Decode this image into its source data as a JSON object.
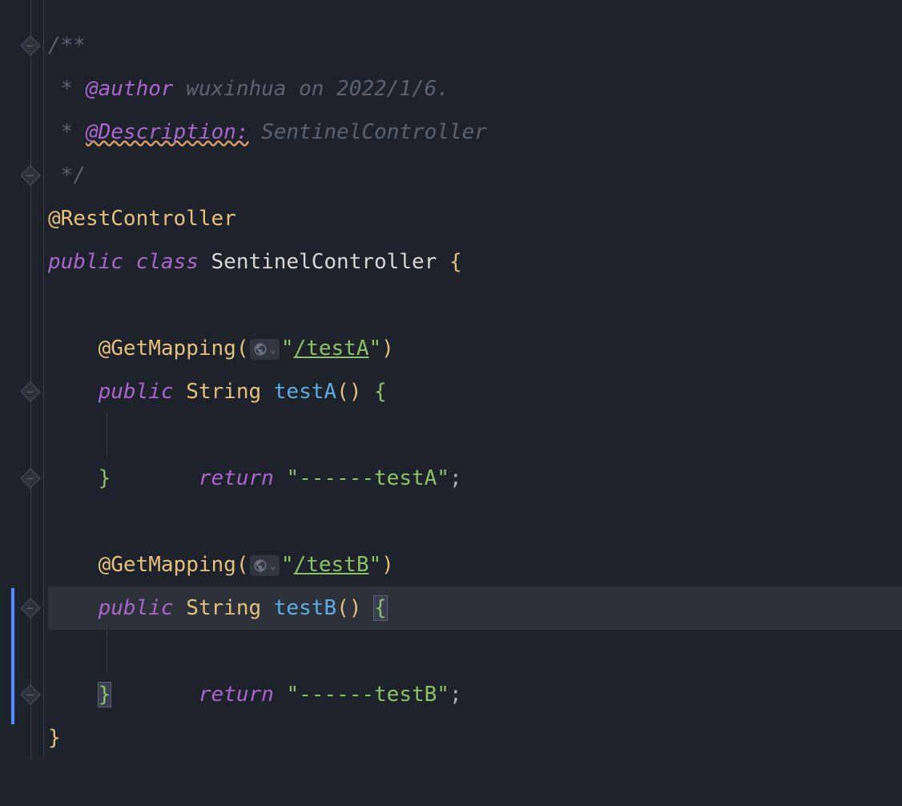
{
  "code": {
    "doc_start": "/**",
    "doc_prefix": " * ",
    "author_tag": "@author",
    "author_text": " wuxinhua on 2022/1/6.",
    "desc_tag": "@Description:",
    "desc_text": " SentinelController",
    "doc_end": " */",
    "annotation_rest": "@RestController",
    "kw_public": "public",
    "kw_class": "class",
    "kw_return": "return",
    "class_name": "SentinelController",
    "annotation_get": "@GetMapping",
    "type_string": "String",
    "method_a": "testA",
    "method_b": "testB",
    "path_a": "/testA",
    "path_b": "/testB",
    "ret_a": "------testA",
    "ret_b": "------testB",
    "quote": "\"",
    "open_paren": "(",
    "close_paren": ")",
    "open_brace": "{",
    "close_brace": "}",
    "semicolon": ";",
    "space": " "
  }
}
